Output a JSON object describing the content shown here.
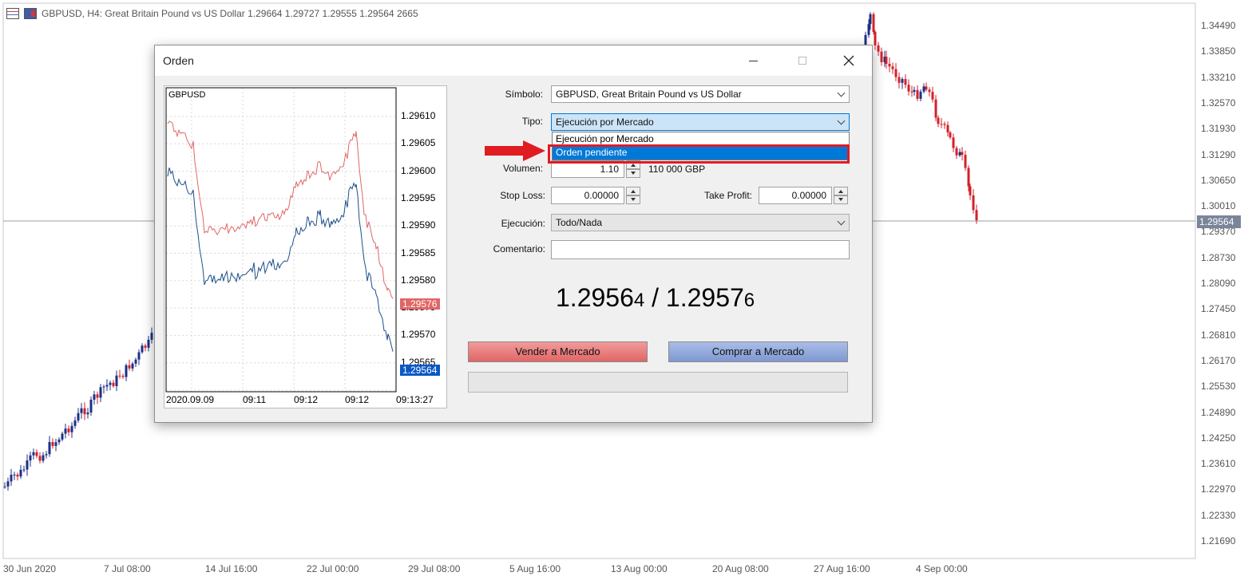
{
  "main_chart": {
    "symbol_title": "GBPUSD, H4:  Great Britain Pound vs US Dollar  1.29664 1.29727 1.29555 1.29564  2665",
    "price_labels": [
      "1.34490",
      "1.33850",
      "1.33210",
      "1.32570",
      "1.31930",
      "1.31290",
      "1.30650",
      "1.30010",
      "1.29370",
      "1.28730",
      "1.28090",
      "1.27450",
      "1.26810",
      "1.26170",
      "1.25530",
      "1.24890",
      "1.24250",
      "1.23610",
      "1.22970",
      "1.22330",
      "1.21690"
    ],
    "current_price": "1.29564",
    "time_labels": [
      "30 Jun 2020",
      "7 Jul 08:00",
      "14 Jul 16:00",
      "22 Jul 00:00",
      "29 Jul 08:00",
      "5 Aug 16:00",
      "13 Aug 00:00",
      "20 Aug 08:00",
      "27 Aug 16:00",
      "4 Sep 00:00"
    ],
    "up_color": "#1f2f86",
    "down_color": "#d3202a"
  },
  "dialog": {
    "title": "Orden",
    "symbol_label": "Símbolo:",
    "symbol_value": "GBPUSD, Great Britain Pound vs US Dollar",
    "type_label": "Tipo:",
    "type_value": "Ejecución por Mercado",
    "type_options": [
      "Ejecución por Mercado",
      "Orden pendiente"
    ],
    "volume_label": "Volumen:",
    "volume_value": "1.10",
    "volume_note": "110 000 GBP",
    "stoploss_label": "Stop Loss:",
    "stoploss_value": "0.00000",
    "takeprofit_label": "Take Profit:",
    "takeprofit_value": "0.00000",
    "execution_label": "Ejecución:",
    "execution_value": "Todo/Nada",
    "comment_label": "Comentario:",
    "comment_value": "",
    "bid_main": "1.2956",
    "bid_small": "4",
    "ask_main": "1.2957",
    "ask_small": "6",
    "quote_separator": " / ",
    "sell_button": "Vender a Mercado",
    "buy_button": "Comprar a Mercado"
  },
  "mini_chart": {
    "symbol": "GBPUSD",
    "price_labels": [
      "1.29610",
      "1.29605",
      "1.29600",
      "1.29595",
      "1.29590",
      "1.29585",
      "1.29580",
      "1.29575",
      "1.29570",
      "1.29565"
    ],
    "ask_tag": "1.29576",
    "bid_tag": "1.29564",
    "time_labels": [
      "2020.09.09",
      "09:11",
      "09:12",
      "09:12",
      "09:13:27"
    ],
    "ask_color": "#e06666",
    "bid_color": "#0a58c8"
  }
}
